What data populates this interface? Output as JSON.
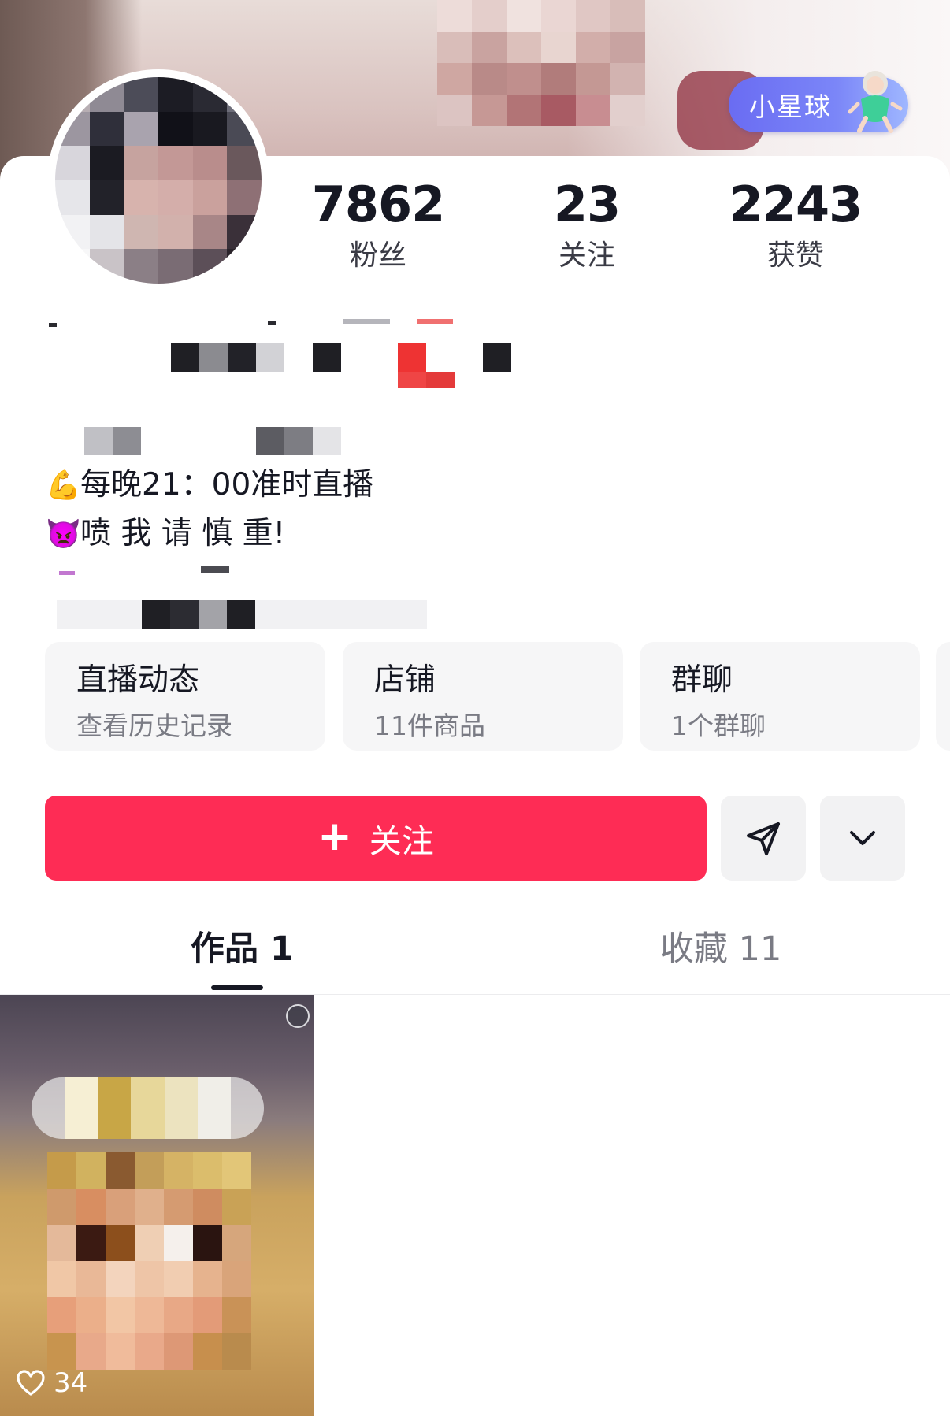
{
  "header": {
    "badge_label": "小星球"
  },
  "stats": [
    {
      "value": "7862",
      "label": "粉丝"
    },
    {
      "value": "23",
      "label": "关注"
    },
    {
      "value": "2243",
      "label": "获赞"
    }
  ],
  "bio": {
    "line1_emoji": "💪",
    "line1_text": "每晚21：00准时直播",
    "line2_emoji": "👿",
    "line2_text": "喷 我 请 慎 重!"
  },
  "features": [
    {
      "title": "直播动态",
      "subtitle": "查看历史记录"
    },
    {
      "title": "店铺",
      "subtitle": "11件商品"
    },
    {
      "title": "群聊",
      "subtitle": "1个群聊"
    }
  ],
  "actions": {
    "follow_icon": "+",
    "follow_label": "关注",
    "share_icon": "send-icon",
    "more_icon": "chevron-down-icon"
  },
  "tabs": [
    {
      "label": "作品 1",
      "active": true
    },
    {
      "label": "收藏 11",
      "active": false
    }
  ],
  "videos": [
    {
      "likes": "34"
    }
  ],
  "colors": {
    "accent": "#fe2c55",
    "badge": "#6a6cf2",
    "text_primary": "#161823",
    "text_secondary": "#7a7b84"
  }
}
